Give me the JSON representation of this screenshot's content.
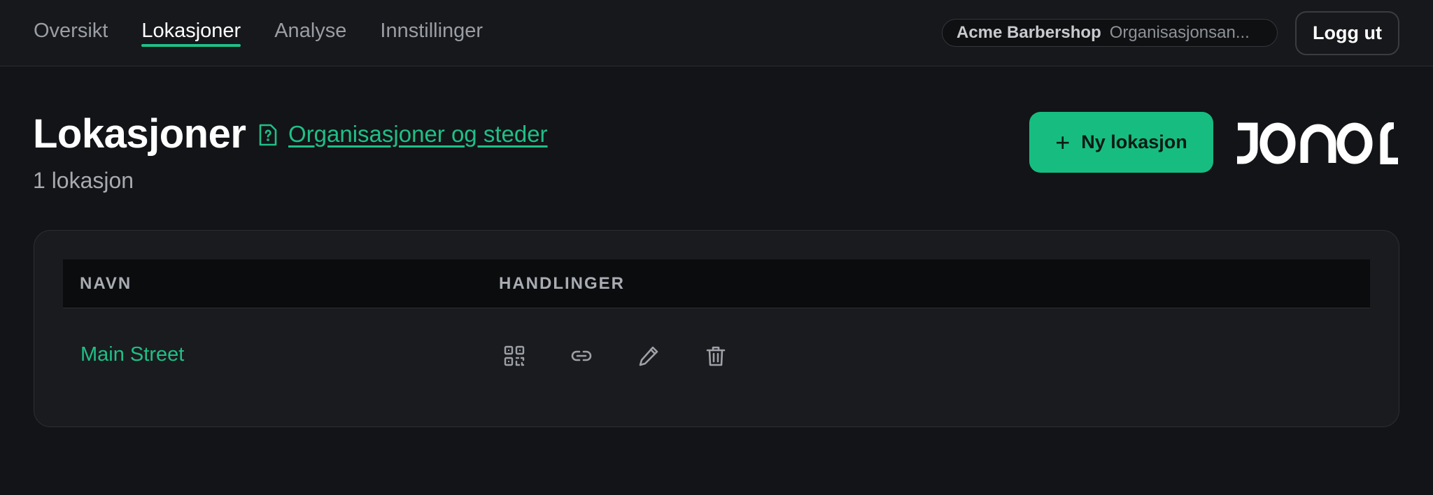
{
  "nav": {
    "tabs": [
      {
        "label": "Oversikt",
        "active": false
      },
      {
        "label": "Lokasjoner",
        "active": true
      },
      {
        "label": "Analyse",
        "active": false
      },
      {
        "label": "Innstillinger",
        "active": false
      }
    ]
  },
  "account": {
    "org_name": "Acme Barbershop",
    "org_role": "Organisasjonsan...",
    "logout_label": "Logg ut"
  },
  "header": {
    "title": "Lokasjoner",
    "org_link": "Organisasjoner og steder",
    "count": "1 lokasjon",
    "new_button": "Ny lokasjon",
    "logo_text": "JONOT"
  },
  "table": {
    "columns": [
      "NAVN",
      "HANDLINGER"
    ],
    "rows": [
      {
        "name": "Main Street",
        "actions": [
          "qr-code-icon",
          "link-icon",
          "edit-icon",
          "delete-icon"
        ]
      }
    ]
  },
  "colors": {
    "accent": "#1fbf86",
    "button": "#17bd80",
    "background": "#131417",
    "card": "#1a1b1e"
  }
}
